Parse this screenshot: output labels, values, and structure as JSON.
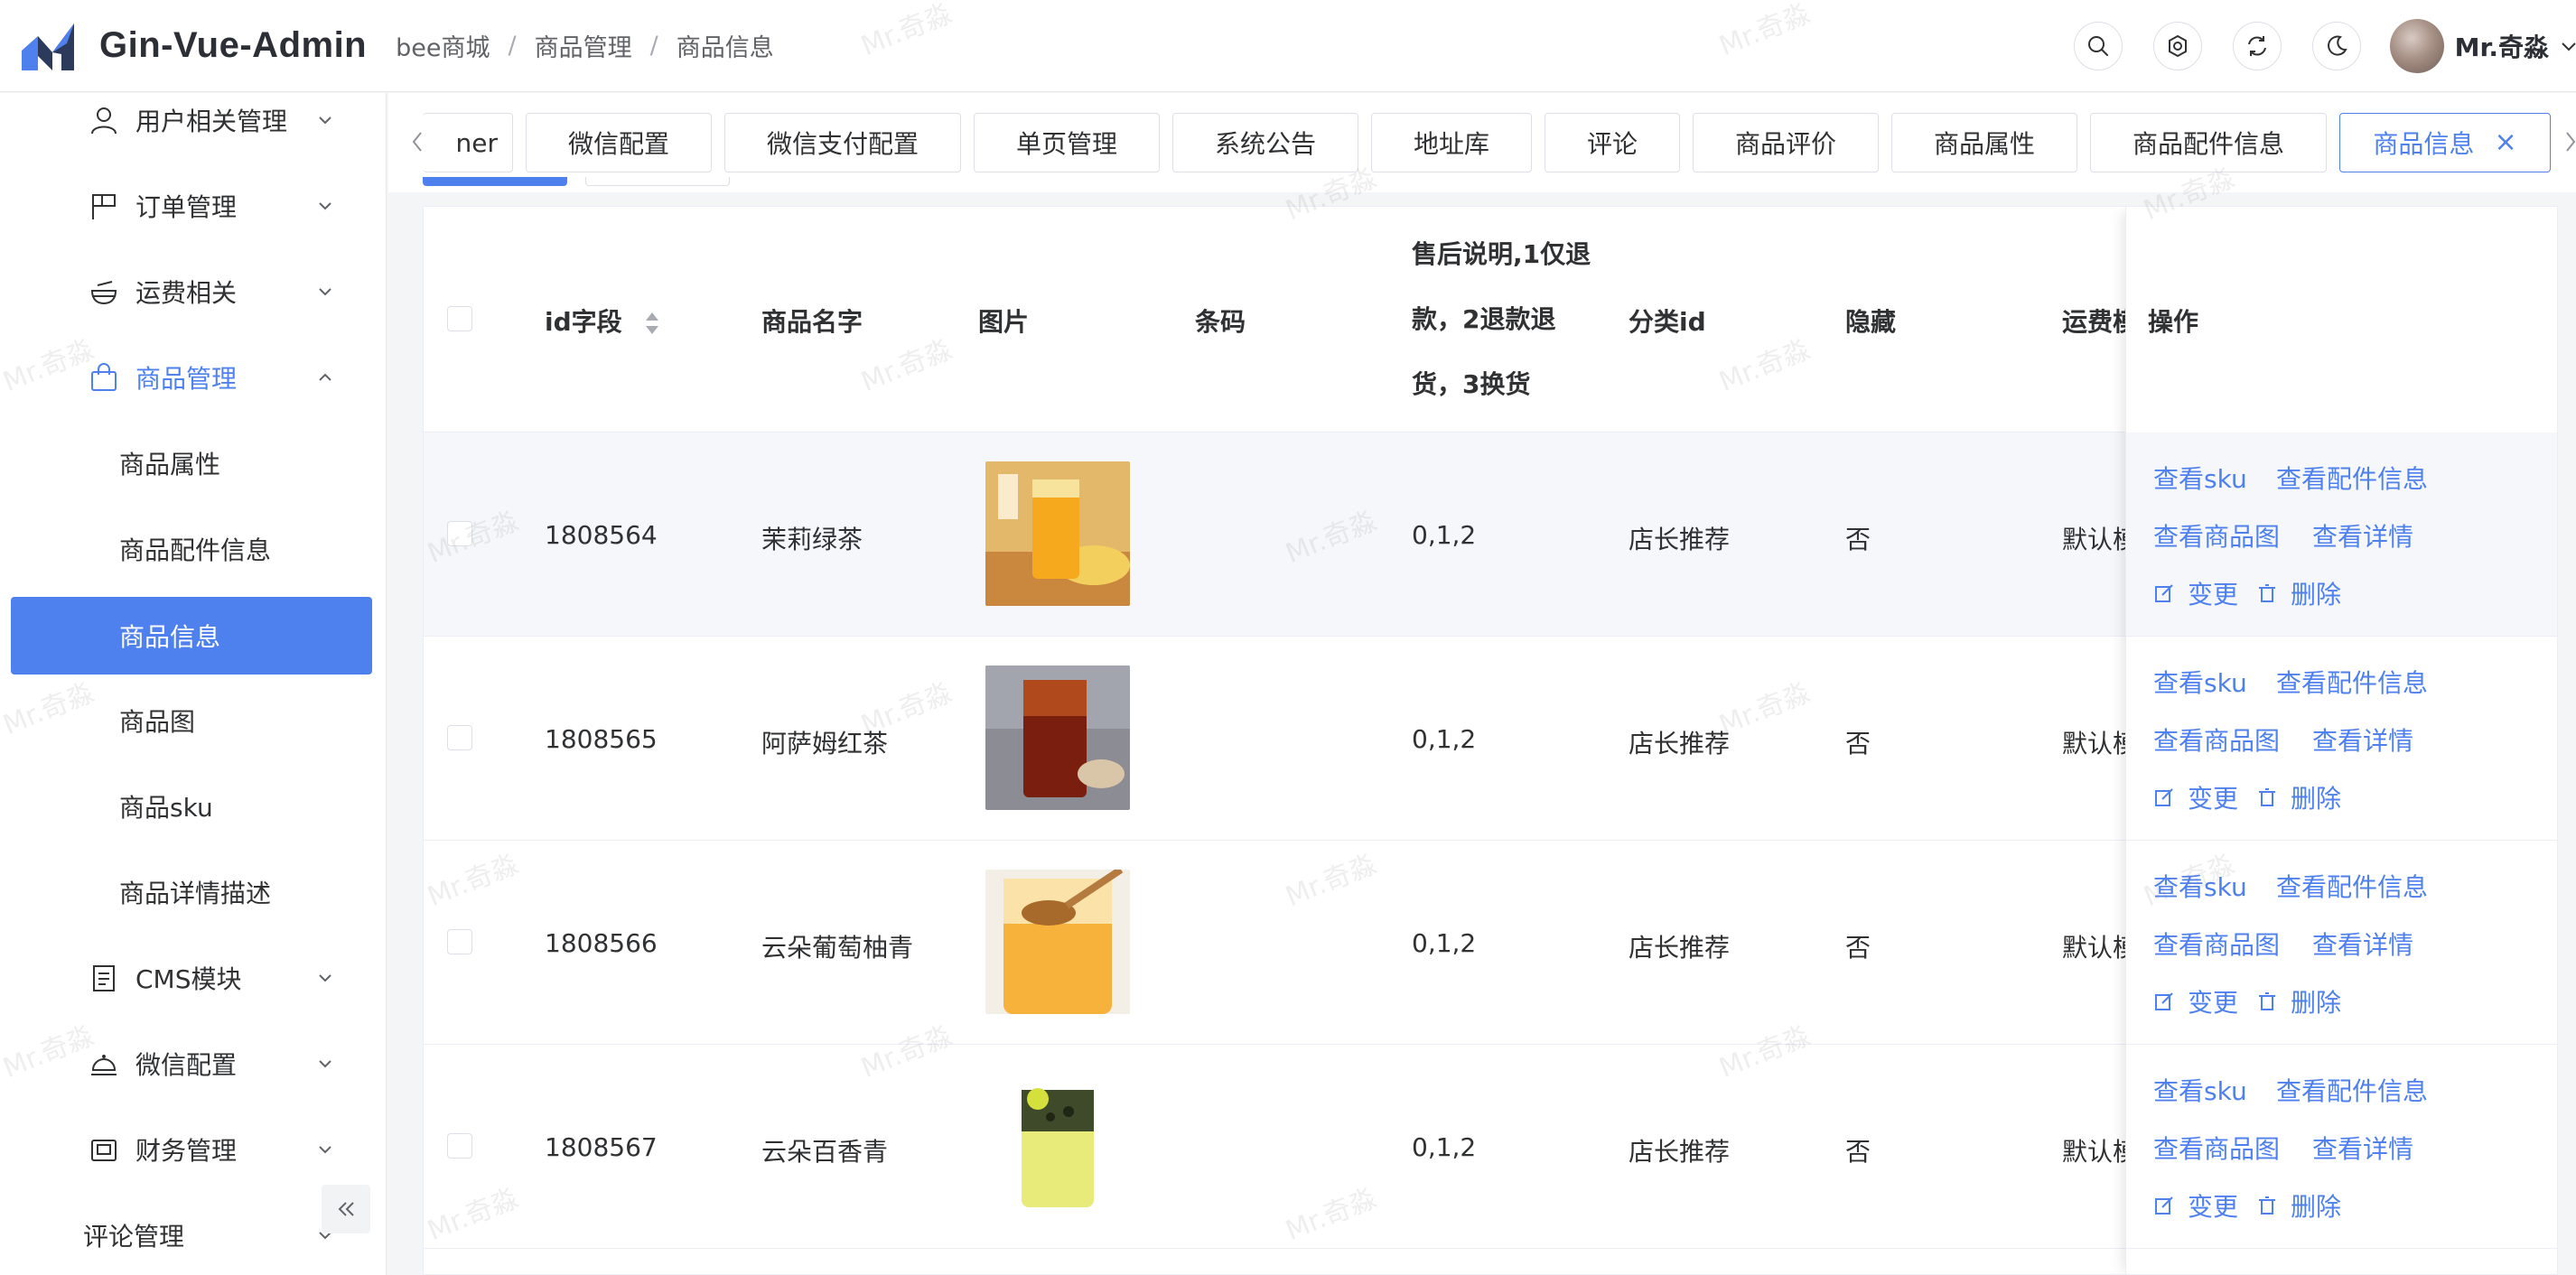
{
  "app": {
    "title": "Gin-Vue-Admin"
  },
  "breadcrumb": [
    "bee商城",
    "商品管理",
    "商品信息"
  ],
  "user": {
    "name": "Mr.奇淼"
  },
  "header_icons": [
    "search-icon",
    "gear-icon",
    "refresh-icon",
    "moon-icon"
  ],
  "sidebar": {
    "menus": [
      {
        "label": "用户相关管理",
        "icon": "user-icon",
        "expanded": false
      },
      {
        "label": "订单管理",
        "icon": "flag-icon",
        "expanded": false
      },
      {
        "label": "运费相关",
        "icon": "bowl-icon",
        "expanded": false
      },
      {
        "label": "商品管理",
        "icon": "shopping-bag-icon",
        "expanded": true
      },
      {
        "label": "CMS模块",
        "icon": "document-icon",
        "expanded": false
      },
      {
        "label": "微信配置",
        "icon": "dish-icon",
        "expanded": false
      },
      {
        "label": "财务管理",
        "icon": "wallet-icon",
        "expanded": false
      },
      {
        "label": "评论管理",
        "icon": "",
        "expanded": false
      }
    ],
    "submenu": [
      {
        "label": "商品属性",
        "selected": false
      },
      {
        "label": "商品配件信息",
        "selected": false
      },
      {
        "label": "商品信息",
        "selected": true
      },
      {
        "label": "商品图",
        "selected": false
      },
      {
        "label": "商品sku",
        "selected": false
      },
      {
        "label": "商品详情描述",
        "selected": false
      }
    ]
  },
  "tabs": [
    {
      "label": "ner",
      "active": false
    },
    {
      "label": "微信配置",
      "active": false
    },
    {
      "label": "微信支付配置",
      "active": false
    },
    {
      "label": "单页管理",
      "active": false
    },
    {
      "label": "系统公告",
      "active": false
    },
    {
      "label": "地址库",
      "active": false
    },
    {
      "label": "评论",
      "active": false
    },
    {
      "label": "商品评价",
      "active": false
    },
    {
      "label": "商品属性",
      "active": false
    },
    {
      "label": "商品配件信息",
      "active": false
    },
    {
      "label": "商品信息",
      "active": true,
      "close": "×"
    }
  ],
  "table": {
    "headers": {
      "id": "id字段",
      "name": "商品名字",
      "image": "图片",
      "barcode": "条码",
      "after_sale": [
        "售后说明,1仅退",
        "款，2退款退",
        "货，3换货"
      ],
      "category": "分类id",
      "hidden": "隐藏",
      "freight": "运费模",
      "ops": "操作"
    },
    "rows": [
      {
        "id": "1808564",
        "name": "茉莉绿茶",
        "image": "orange-tea-photo",
        "barcode": "",
        "after_sale": "0,1,2",
        "category": "店长推荐",
        "hidden": "否",
        "freight": "默认模"
      },
      {
        "id": "1808565",
        "name": "阿萨姆红茶",
        "image": "red-tea-photo",
        "barcode": "",
        "after_sale": "0,1,2",
        "category": "店长推荐",
        "hidden": "否",
        "freight": "默认模"
      },
      {
        "id": "1808566",
        "name": "云朵葡萄柚青",
        "image": "grapefruit-tea-photo",
        "barcode": "",
        "after_sale": "0,1,2",
        "category": "店长推荐",
        "hidden": "否",
        "freight": "默认模"
      },
      {
        "id": "1808567",
        "name": "云朵百香青",
        "image": "passionfruit-tea-photo",
        "barcode": "",
        "after_sale": "0,1,2",
        "category": "店长推荐",
        "hidden": "否",
        "freight": "默认模"
      }
    ],
    "actions": {
      "view_sku": "查看sku",
      "view_parts": "查看配件信息",
      "view_images": "查看商品图",
      "view_detail": "查看详情",
      "edit": "变更",
      "delete": "删除"
    }
  },
  "watermark": "Mr.奇淼",
  "colors": {
    "primary": "#4e80ee",
    "text": "#303133",
    "border": "#dcdfe6"
  }
}
